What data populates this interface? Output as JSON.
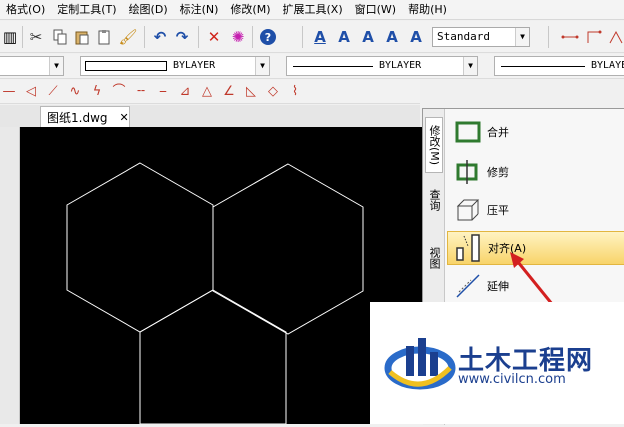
{
  "menu": {
    "items": [
      "格式(O)",
      "定制工具(T)",
      "绘图(D)",
      "标注(N)",
      "修改(M)",
      "扩展工具(X)",
      "窗口(W)",
      "帮助(H)"
    ]
  },
  "toolbar": {
    "text_style": "Standard",
    "icons": [
      "print-icon",
      "cut-icon",
      "copy-icon",
      "paste-icon",
      "clipboard-icon",
      "brush-icon",
      "undo-icon",
      "redo-icon",
      "delete-icon",
      "explode-icon",
      "help-icon",
      "text-a-underline-icon",
      "text-a-icon",
      "text-edit-icon",
      "text-find-icon",
      "text-style-icon"
    ]
  },
  "properties": {
    "color": "BYLAYER",
    "linetype": "BYLAYER",
    "lineweight": "BYLAYER"
  },
  "document": {
    "tab_label": "图纸1.dwg",
    "close_glyph": "✕"
  },
  "panel": {
    "vertical_tabs": [
      "修改(M)",
      "查询",
      "视图"
    ],
    "tools": [
      {
        "label": "合并",
        "icon": "join-icon"
      },
      {
        "label": "修剪",
        "icon": "trim-icon"
      },
      {
        "label": "压平",
        "icon": "flatten-icon"
      },
      {
        "label": "对齐(A)",
        "icon": "align-icon"
      },
      {
        "label": "延伸",
        "icon": "extend-icon"
      }
    ]
  },
  "watermark": {
    "title": "土木工程网",
    "url": "www.civilcn.com"
  },
  "colors": {
    "canvas": "#000000",
    "lines": "#ffffff",
    "selected_row": "#f8d46a",
    "arrow": "#d32020",
    "watermark_text": "#1b3f8f"
  }
}
